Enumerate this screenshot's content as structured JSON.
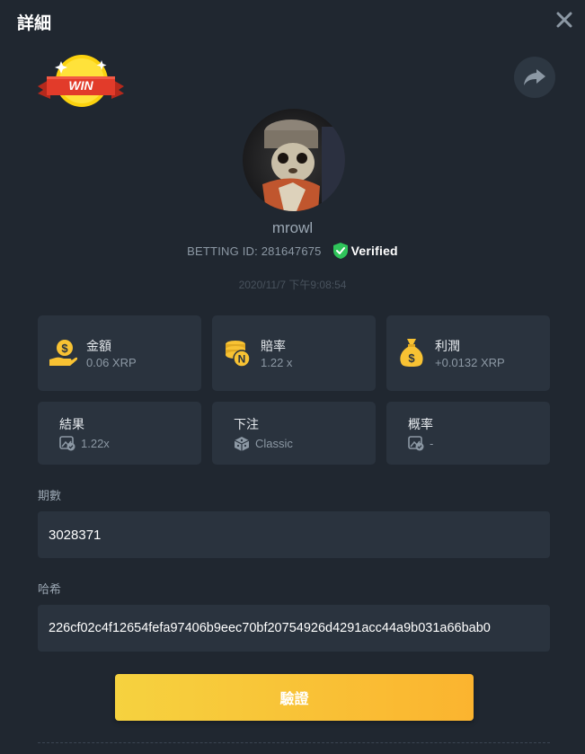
{
  "header": {
    "title": "詳細"
  },
  "badge": {
    "text": "WIN"
  },
  "user": {
    "name": "mrowl",
    "betting_id_label": "BETTING ID: 281647675",
    "verified_label": "Verified",
    "timestamp": "2020/11/7 下午9:08:54"
  },
  "stats": [
    {
      "label": "金額",
      "value": "0.06 XRP",
      "icon": "money-hand-icon"
    },
    {
      "label": "賠率",
      "value": "1.22 x",
      "icon": "coin-stack-icon"
    },
    {
      "label": "利潤",
      "value": "+0.0132 XRP",
      "icon": "money-bag-icon"
    },
    {
      "label": "結果",
      "value": "1.22x",
      "icon": "image-check-icon"
    },
    {
      "label": "下注",
      "value": "Classic",
      "icon": "dice-icon"
    },
    {
      "label": "概率",
      "value": "-",
      "icon": "image-check-icon"
    }
  ],
  "round": {
    "label": "期數",
    "value": "3028371"
  },
  "hash": {
    "label": "哈希",
    "value": "226cf02c4f12654fefa97406b9eec70bf20754926d4291acc44a9b031a66bab0"
  },
  "verify_button": {
    "label": "驗證"
  },
  "colors": {
    "background": "#202730",
    "card": "#2a333e",
    "accent": "#f8c233",
    "verified": "#2fc45a"
  }
}
